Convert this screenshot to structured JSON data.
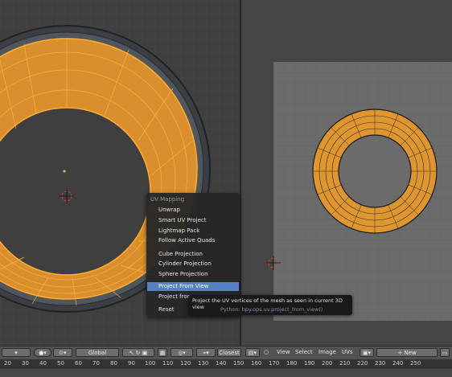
{
  "uv_menu": {
    "title": "UV Mapping",
    "items": [
      {
        "label": "Unwrap",
        "active": false
      },
      {
        "label": "Smart UV Project",
        "active": false
      },
      {
        "label": "Lightmap Pack",
        "active": false
      },
      {
        "label": "Follow Active Quads",
        "active": false
      },
      {
        "label": "Cube Projection",
        "active": false
      },
      {
        "label": "Cylinder Projection",
        "active": false
      },
      {
        "label": "Sphere Projection",
        "active": false
      },
      {
        "label": "Project From View",
        "active": true
      },
      {
        "label": "Project fron",
        "active": false
      },
      {
        "label": "Reset",
        "active": false
      }
    ]
  },
  "tooltip": {
    "description": "Project the UV vertices of the mesh as seen in current 3D view",
    "python": "Python: bpy.ops.uv.project_from_view()"
  },
  "header_3d": {
    "orientation": "Global"
  },
  "header_uv": {
    "snap_mode": "Closest",
    "menus": [
      "View",
      "Select",
      "Image",
      "UVs"
    ],
    "new_button": "New"
  },
  "timeline_ticks": [
    "20",
    "30",
    "40",
    "50",
    "60",
    "70",
    "80",
    "90",
    "100",
    "110",
    "120",
    "130",
    "140",
    "150",
    "160",
    "170",
    "180",
    "190",
    "200",
    "210",
    "220",
    "230",
    "240",
    "250"
  ],
  "colors": {
    "mesh_orange": "#e89a2c",
    "edge_orange": "#ffad33",
    "menu_highlight": "#5680c2",
    "uv_grid": "#6b6b6b"
  }
}
